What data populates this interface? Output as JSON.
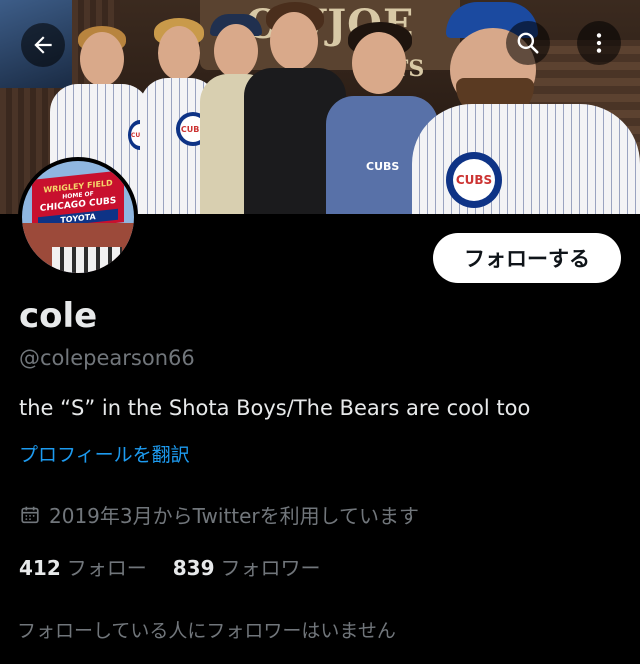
{
  "profile": {
    "display_name": "cole",
    "handle": "@colepearson66",
    "bio": "the “S” in the Shota Boys/The Bears are cool too",
    "translate_link": "プロフィールを翻訳",
    "joined": "2019年3月からTwitterを利用しています",
    "following_count": "412",
    "following_label": "フォロー",
    "followers_count": "839",
    "followers_label": "フォロワー",
    "mutual_note": "フォローしている人にフォロワーはいません"
  },
  "actions": {
    "follow_label": "フォローする"
  },
  "icons": {
    "back": "back-arrow-icon",
    "search": "search-icon",
    "more": "more-vertical-icon",
    "calendar": "calendar-icon"
  },
  "banner": {
    "sign_text": "OWJOE",
    "sign_text_2": "TS",
    "cubs_logo_text": "CUBS",
    "shirt_text": "CUBS"
  },
  "avatar": {
    "marquee_line1": "WRIGLEY FIELD",
    "marquee_line2": "HOME OF",
    "marquee_line3": "CHICAGO CUBS",
    "marquee_sponsor": "TOYOTA"
  },
  "colors": {
    "background": "#000000",
    "primary_text": "#e7e9ea",
    "secondary_text": "#71767b",
    "link": "#1d9bf0",
    "follow_button_bg": "#ffffff",
    "cubs_blue": "#0e3386",
    "cubs_red": "#cc3433"
  }
}
